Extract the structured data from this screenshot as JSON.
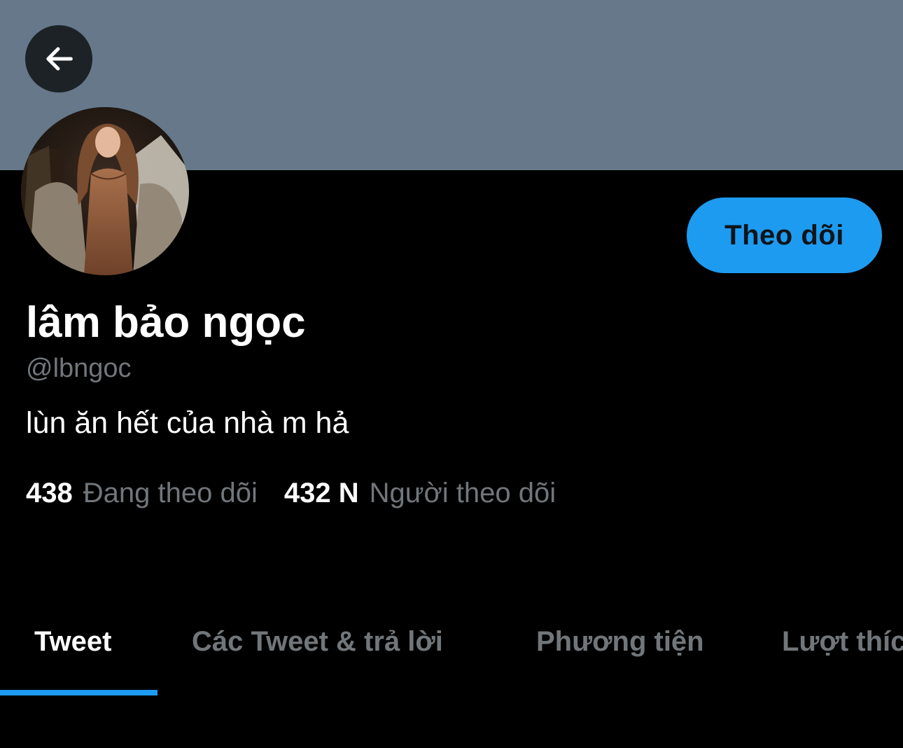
{
  "header": {
    "back_icon": "arrow-left-icon",
    "banner_color": "#66788a"
  },
  "profile": {
    "avatar": "profile-photo",
    "display_name": "lâm bảo ngọc",
    "handle": "@lbngoc",
    "bio": "lùn ăn hết của nhà m hả",
    "follow_button_label": "Theo dõi",
    "accent_color": "#1d9bf0"
  },
  "stats": {
    "following_count": "438",
    "following_label": "Đang theo dõi",
    "followers_count": "432 N",
    "followers_label": "Người theo dõi"
  },
  "tabs": [
    {
      "label": "Tweet",
      "active": true
    },
    {
      "label": "Các Tweet & trả lời",
      "active": false
    },
    {
      "label": "Phương tiện",
      "active": false
    },
    {
      "label": "Lượt thích",
      "active": false
    }
  ]
}
